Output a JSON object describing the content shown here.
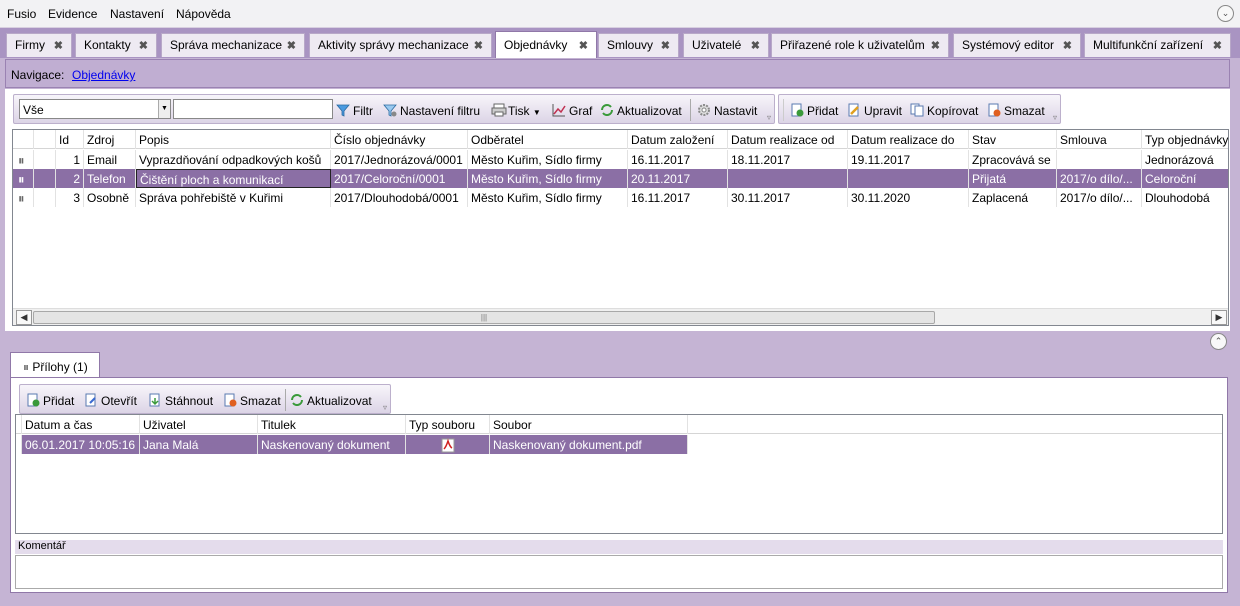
{
  "menu": {
    "items": [
      "Fusio",
      "Evidence",
      "Nastavení",
      "Nápověda"
    ]
  },
  "tabs": [
    {
      "label": "Firmy"
    },
    {
      "label": "Kontakty"
    },
    {
      "label": "Správa mechanizace"
    },
    {
      "label": "Aktivity správy mechanizace"
    },
    {
      "label": "Objednávky"
    },
    {
      "label": "Smlouvy"
    },
    {
      "label": "Uživatelé"
    },
    {
      "label": "Přiřazené role k uživatelům"
    },
    {
      "label": "Systémový editor"
    },
    {
      "label": "Multifunkční zařízení"
    }
  ],
  "nav": {
    "label": "Navigace:",
    "link": "Objednávky"
  },
  "toolbar": {
    "filter_select": "Vše",
    "search_value": "",
    "filter": "Filtr",
    "filter_settings": "Nastavení filtru",
    "print": "Tisk",
    "chart": "Graf",
    "refresh": "Aktualizovat",
    "settings": "Nastavit",
    "add": "Přidat",
    "edit": "Upravit",
    "copy": "Kopírovat",
    "delete": "Smazat"
  },
  "orders": {
    "columns": [
      "Id",
      "Zdroj",
      "Popis",
      "Číslo objednávky",
      "Odběratel",
      "Datum založení",
      "Datum realizace od",
      "Datum realizace do",
      "Stav",
      "Smlouva",
      "Typ objednávky"
    ],
    "rows": [
      {
        "id": "1",
        "zdroj": "Email",
        "popis": "Vyprazdňování odpadkových košů",
        "cislo": "2017/Jednorázová/0001",
        "odberatel": "Město Kuřim, Sídlo firmy",
        "zalozeni": "16.11.2017",
        "od": "18.11.2017",
        "do": "19.11.2017",
        "stav": "Zpracovává se",
        "smlouva": "",
        "typ": "Jednorázová"
      },
      {
        "id": "2",
        "zdroj": "Telefon",
        "popis": "Čištění ploch a komunikací",
        "cislo": "2017/Celoroční/0001",
        "odberatel": "Město Kuřim, Sídlo firmy",
        "zalozeni": "20.11.2017",
        "od": "",
        "do": "",
        "stav": "Přijatá",
        "smlouva": "2017/o dílo/...",
        "typ": "Celoroční"
      },
      {
        "id": "3",
        "zdroj": "Osobně",
        "popis": "Správa pohřebiště v Kuřimi",
        "cislo": "2017/Dlouhodobá/0001",
        "odberatel": "Město Kuřim, Sídlo firmy",
        "zalozeni": "16.11.2017",
        "od": "30.11.2017",
        "do": "30.11.2020",
        "stav": "Zaplacená",
        "smlouva": "2017/o dílo/...",
        "typ": "Dlouhodobá"
      }
    ],
    "selected_index": 1
  },
  "attachments": {
    "tab_label": "Přílohy (1)",
    "toolbar": {
      "add": "Přidat",
      "open": "Otevřít",
      "download": "Stáhnout",
      "delete": "Smazat",
      "refresh": "Aktualizovat"
    },
    "columns": [
      "Datum a čas",
      "Uživatel",
      "Titulek",
      "Typ souboru",
      "Soubor"
    ],
    "rows": [
      {
        "datum": "06.01.2017 10:05:16",
        "uzivatel": "Jana Malá",
        "titulek": "Naskenovaný dokument",
        "typ_icon": "pdf-icon",
        "soubor": "Naskenovaný dokument.pdf"
      }
    ],
    "comment_label": "Komentář",
    "comment_value": ""
  },
  "colors": {
    "accent": "#8b6fa5",
    "tabbar": "#a994c2",
    "background": "#c5b4d4"
  }
}
